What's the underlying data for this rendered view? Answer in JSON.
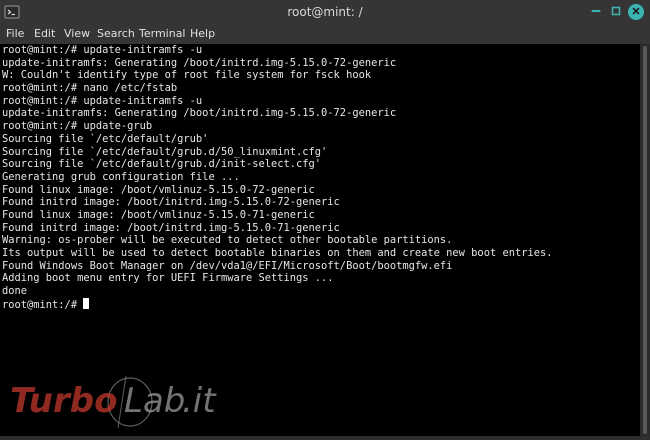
{
  "window": {
    "title": "root@mint: /"
  },
  "menu": [
    "File",
    "Edit",
    "View",
    "Search",
    "Terminal",
    "Help"
  ],
  "terminal": {
    "lines": [
      "root@mint:/# update-initramfs -u",
      "update-initramfs: Generating /boot/initrd.img-5.15.0-72-generic",
      "W: Couldn't identify type of root file system for fsck hook",
      "root@mint:/# nano /etc/fstab",
      "root@mint:/# update-initramfs -u",
      "update-initramfs: Generating /boot/initrd.img-5.15.0-72-generic",
      "root@mint:/# update-grub",
      "Sourcing file `/etc/default/grub'",
      "Sourcing file `/etc/default/grub.d/50_linuxmint.cfg'",
      "Sourcing file `/etc/default/grub.d/init-select.cfg'",
      "Generating grub configuration file ...",
      "Found linux image: /boot/vmlinuz-5.15.0-72-generic",
      "Found initrd image: /boot/initrd.img-5.15.0-72-generic",
      "Found linux image: /boot/vmlinuz-5.15.0-71-generic",
      "Found initrd image: /boot/initrd.img-5.15.0-71-generic",
      "Warning: os-prober will be executed to detect other bootable partitions.",
      "Its output will be used to detect bootable binaries on them and create new boot entries.",
      "Found Windows Boot Manager on /dev/vda1@/EFI/Microsoft/Boot/bootmgfw.efi",
      "Adding boot menu entry for UEFI Firmware Settings ...",
      "done"
    ],
    "prompt": "root@mint:/# "
  },
  "watermark": {
    "text_part1": "Turbo",
    "text_part2": "Lab",
    "text_part3": ".it",
    "color_primary": "#c0392b",
    "color_secondary": "#9a9a9a"
  },
  "colors": {
    "terminal_bg": "#000000",
    "terminal_fg": "#e6e6e6",
    "chrome_bg": "#353535",
    "close_button": "#3cb4b4"
  },
  "icons": {
    "app": "terminal-icon",
    "minimize": "minimize-icon",
    "maximize": "maximize-icon",
    "close": "close-icon"
  }
}
